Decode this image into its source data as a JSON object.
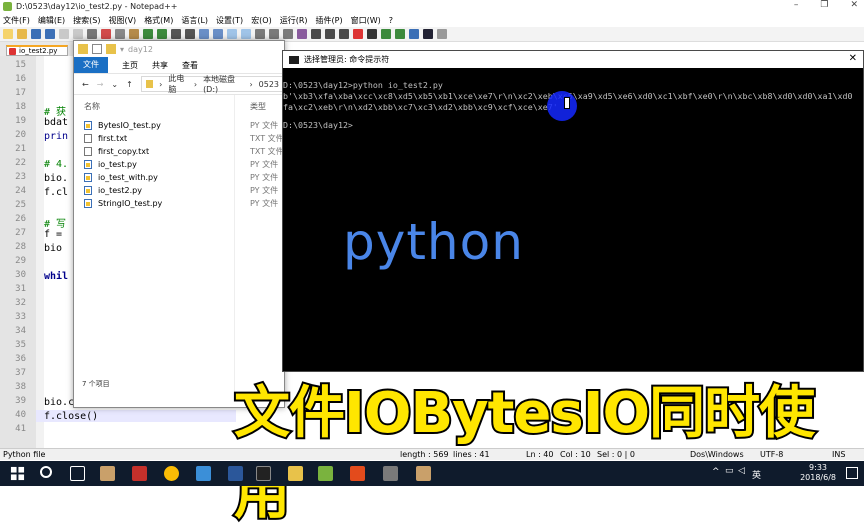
{
  "npp": {
    "title": "D:\\0523\\day12\\io_test2.py - Notepad++",
    "menu": [
      "文件(F)",
      "编辑(E)",
      "搜索(S)",
      "视图(V)",
      "格式(M)",
      "语言(L)",
      "设置(T)",
      "宏(O)",
      "运行(R)",
      "插件(P)",
      "窗口(W)",
      "?"
    ],
    "tab": "io_test2.py",
    "line_numbers": [
      "15",
      "16",
      "17",
      "18",
      "19",
      "20",
      "21",
      "22",
      "23",
      "24",
      "25",
      "26",
      "27",
      "28",
      "29",
      "30",
      "31",
      "32",
      "33",
      "34",
      "35",
      "36",
      "37",
      "38",
      "39",
      "40",
      "41"
    ],
    "code": {
      "l18": "# 获",
      "l19": "bdat",
      "l20": "prin",
      "l22": "# 4.",
      "l23": "bio.",
      "l24": "f.cl",
      "l26": "# 写",
      "l27": "f = ",
      "l28": "bio ",
      "l30": "whil",
      "l39": "bio.close()",
      "l40": "f.close()"
    },
    "status": {
      "lang": "Python file",
      "length": "length : 569",
      "lines": "lines : 41",
      "ln": "Ln : 40",
      "col": "Col : 10",
      "sel": "Sel : 0 | 0",
      "eol": "Dos\\Windows",
      "encoding": "UTF-8",
      "mode": "INS"
    }
  },
  "explorer": {
    "title": "day12",
    "ribbon": [
      "文件",
      "主页",
      "共享",
      "查看"
    ],
    "address": [
      "此电脑",
      "本地磁盘 (D:)",
      "0523"
    ],
    "col_name": "名称",
    "col_type": "类型",
    "files": [
      {
        "name": "BytesIO_test.py",
        "type": "PY 文件",
        "kind": "py"
      },
      {
        "name": "first.txt",
        "type": "TXT 文件",
        "kind": "txt"
      },
      {
        "name": "first_copy.txt",
        "type": "TXT 文件",
        "kind": "txt"
      },
      {
        "name": "io_test.py",
        "type": "PY 文件",
        "kind": "py"
      },
      {
        "name": "io_test_with.py",
        "type": "PY 文件",
        "kind": "py"
      },
      {
        "name": "io_test2.py",
        "type": "PY 文件",
        "kind": "py"
      },
      {
        "name": "StringIO_test.py",
        "type": "PY 文件",
        "kind": "py"
      }
    ],
    "count": "7 个项目"
  },
  "cmd": {
    "title": "选择管理员: 命令提示符",
    "lines": [
      "D:\\0523\\day12>python io_test2.py",
      "b'\\xb3\\xfa\\xba\\xcc\\xc8\\xd5\\xb5\\xb1\\xce\\xe7\\r\\n\\xc2\\xeb\\xc5\\xa9\\xd5\\xe6\\xd0\\xc1\\xbf\\xe0\\r\\n\\xbc\\xb8\\xd0\\xd0\\xa1\\xd0",
      "fa\\xc2\\xeb\\r\\n\\xd2\\xbb\\xc7\\xc3\\xd2\\xbb\\xc9\\xcf\\xce\\xe7'",
      "",
      "D:\\0523\\day12>"
    ],
    "overlay_text": "python"
  },
  "caption": "文件IOBytesIO同时使用",
  "taskbar": {
    "ime": "英",
    "time": "9:33",
    "date": "2018/6/8"
  },
  "colors": {
    "caption": "#ffe600",
    "python_text": "#4a86e8",
    "cmd_bg": "#000000",
    "taskbar": "#0f1b2c"
  }
}
